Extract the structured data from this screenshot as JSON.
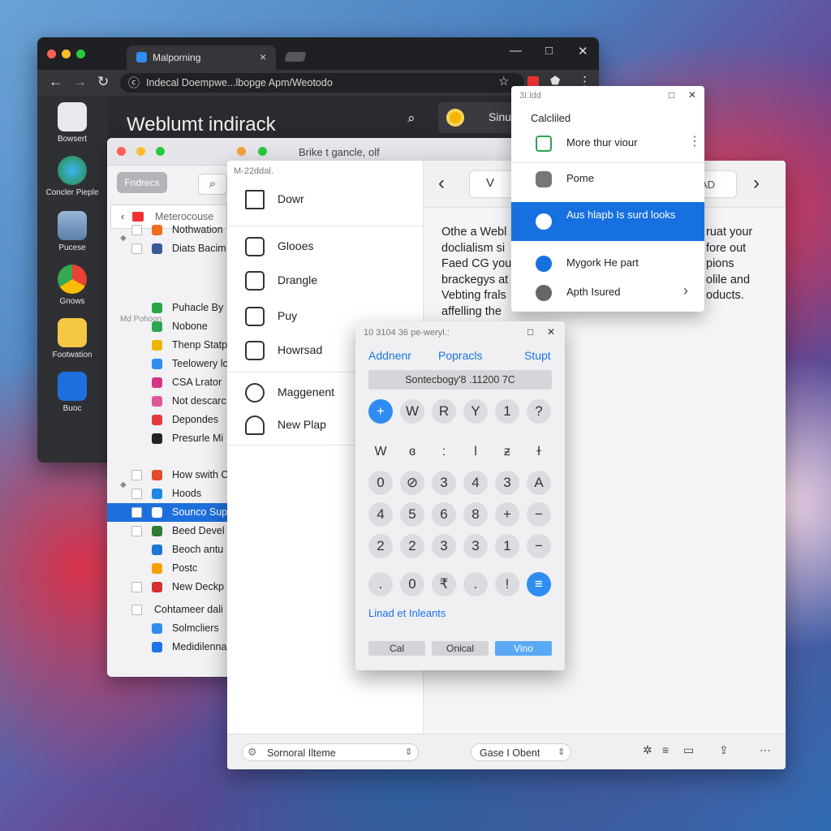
{
  "browser": {
    "tab_title": "Malporning",
    "url": "Indecal Doempwe...lbopge Apm/Weotodo",
    "heading": "Weblumt indirack",
    "chip_label": "Sinu",
    "dock": [
      {
        "label": "Bowsert",
        "icon": "bag-icon"
      },
      {
        "label": "Concler Pieple",
        "icon": "globe-icon"
      },
      {
        "label": "Pucese",
        "icon": "image-icon"
      },
      {
        "label": "Gnows",
        "icon": "chrome-icon"
      },
      {
        "label": "Footwation",
        "icon": "document-icon"
      },
      {
        "label": "Buoc",
        "icon": "bird-icon"
      }
    ]
  },
  "files": {
    "title": "Brike t gancle, olf",
    "pill": "Fndrecs",
    "path": "Meterocouse",
    "group1": "",
    "group2": "Md Pohoon",
    "rows": [
      {
        "label": "Nothwation",
        "color": "#f26b1d",
        "check": true
      },
      {
        "label": "Diats Bacim",
        "color": "#3b5998",
        "check": true
      },
      {
        "label": "Puhacle By",
        "color": "#28a745",
        "check": false
      },
      {
        "label": "Nobone",
        "color": "#2da44e",
        "check": false
      },
      {
        "label": "Thenp Statp",
        "color": "#f0b400",
        "check": false
      },
      {
        "label": "Teelowery lc",
        "color": "#2f8df2",
        "check": false
      },
      {
        "label": "CSA Lrator",
        "color": "#d63384",
        "check": false
      },
      {
        "label": "Not descarc",
        "color": "#e05597",
        "check": false
      },
      {
        "label": "Depondes",
        "color": "#e33b3b",
        "check": false
      },
      {
        "label": "Presurle Mi",
        "color": "#222222",
        "check": false
      },
      {
        "label": "How swith C",
        "color": "#e44b2a",
        "check": true
      },
      {
        "label": "Hoods",
        "color": "#1e88e5",
        "check": true
      },
      {
        "label": "Sounco Supp",
        "color": "#ffffff",
        "check": true,
        "selected": true
      },
      {
        "label": "Beed Devel",
        "color": "#2e7d32",
        "check": true
      },
      {
        "label": "Beoch antu",
        "color": "#1976d2",
        "check": false
      },
      {
        "label": "Postc",
        "color": "#f4a100",
        "check": false
      },
      {
        "label": "New Deckp",
        "color": "#d32f2f",
        "check": true
      },
      {
        "label": "Cohtameer dali",
        "color": "",
        "check": true
      },
      {
        "label": "Solmcliers",
        "color": "#2f8df2",
        "check": false
      },
      {
        "label": "Medidilennaroz",
        "color": "#1a73e8",
        "check": false
      }
    ]
  },
  "app": {
    "menu_header": "M-22ddal.",
    "menu": [
      {
        "label": "Dowr",
        "icon": "home-icon"
      },
      {
        "label": "Glooes",
        "icon": "briefcase-icon"
      },
      {
        "label": "Drangle",
        "icon": "card-icon"
      },
      {
        "label": "Puy",
        "icon": "clipboard-icon"
      },
      {
        "label": "Howrsad",
        "icon": "register-icon"
      },
      {
        "label": "Maggenent",
        "icon": "info-icon"
      },
      {
        "label": "New Plap",
        "icon": "plant-icon"
      }
    ],
    "nav_segment_left": "V",
    "nav_segment_right": "AD",
    "paragraph": [
      "Othe a Webl",
      "doclialism si",
      "Faed CG your",
      "brackegys at",
      "Vebting frals",
      "affelling the"
    ],
    "paragraph_right": [
      "ruat your",
      "fore out",
      "pions",
      "olile and",
      "oducts."
    ],
    "bottom_select1": "Sornoral Ilteme",
    "bottom_select2": "Gase I Obent"
  },
  "context_menu": {
    "header": "3I.ldd",
    "title": "Calcliled",
    "items": [
      {
        "label": "More thur viour",
        "icon": "screen-icon"
      },
      {
        "label": "Pome",
        "icon": "puzzle-icon"
      },
      {
        "label": "Aus hlapb Is surd looks",
        "icon": "person-icon",
        "active": true
      },
      {
        "label": "Mygork He part",
        "icon": "check-circle-icon"
      },
      {
        "label": "Apth Isured",
        "icon": "shield-icon",
        "submenu": true
      }
    ]
  },
  "calculator": {
    "title": "10 3104 36 pe-weryl.:",
    "tabs": [
      "Addnenr",
      "Popracls",
      "Stupt"
    ],
    "display": "Sontecbogy'8 .11200 7C",
    "rows": [
      [
        "+",
        "W",
        "R",
        "Y",
        "1",
        "?"
      ],
      [
        "W",
        "ɞ",
        ":",
        "l",
        "ƶ",
        "ɫ"
      ],
      [
        "0",
        "⊘",
        "3",
        "4",
        "3",
        "A"
      ],
      [
        "4",
        "5",
        "6",
        "8",
        "+",
        "−"
      ],
      [
        "2",
        "2",
        "3",
        "3",
        "1",
        "−"
      ],
      [
        ".",
        "0",
        "₹",
        ".",
        "!",
        "≡"
      ]
    ],
    "link": "Linad et Inleants",
    "buttons": [
      "Cal",
      "Onical",
      "Vino"
    ]
  }
}
